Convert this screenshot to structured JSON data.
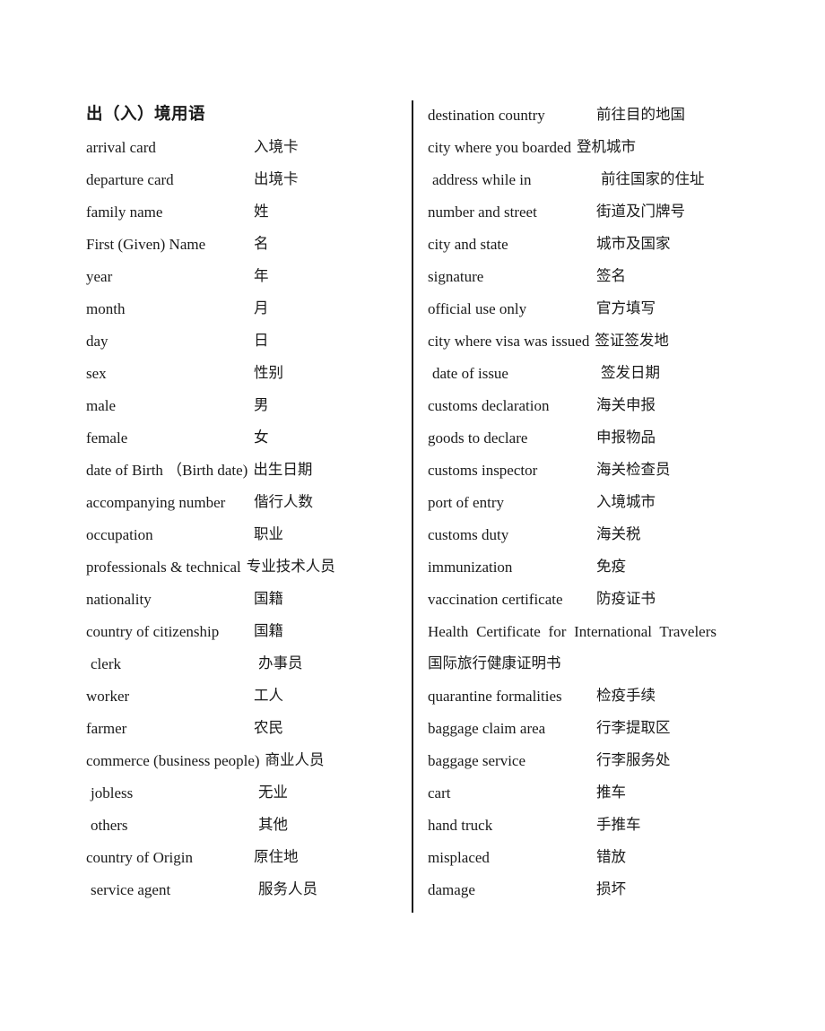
{
  "document": {
    "background_color": "#ffffff",
    "text_color": "#1a1a1a",
    "divider_color": "#1a1a1a"
  },
  "left_column": {
    "title": "出（入）境用语",
    "entries": [
      {
        "en": "arrival card",
        "zh": "入境卡"
      },
      {
        "en": "departure card",
        "zh": "出境卡"
      },
      {
        "en": "family name",
        "zh": "姓"
      },
      {
        "en": "First (Given) Name",
        "zh": "名"
      },
      {
        "en": "year",
        "zh": "年"
      },
      {
        "en": "month",
        "zh": "月"
      },
      {
        "en": "day",
        "zh": "日"
      },
      {
        "en": "sex",
        "zh": "性别"
      },
      {
        "en": "male",
        "zh": "男"
      },
      {
        "en": "female",
        "zh": "女"
      },
      {
        "en": "date of Birth （Birth date)",
        "zh": "出生日期"
      },
      {
        "en": "accompanying number",
        "zh": "偕行人数"
      },
      {
        "en": "occupation",
        "zh": "职业"
      },
      {
        "en": "professionals & technical",
        "zh": "专业技术人员"
      },
      {
        "en": "nationality",
        "zh": "国籍"
      },
      {
        "en": "country of citizenship",
        "zh": "国籍"
      },
      {
        "en": "clerk",
        "zh": "办事员"
      },
      {
        "en": "worker",
        "zh": "工人"
      },
      {
        "en": "farmer",
        "zh": "农民"
      },
      {
        "en": "commerce (business people)",
        "zh": "商业人员"
      },
      {
        "en": "jobless",
        "zh": "无业"
      },
      {
        "en": "others",
        "zh": "其他"
      },
      {
        "en": "country of Origin",
        "zh": "原住地"
      },
      {
        "en": "service agent",
        "zh": "服务人员"
      }
    ]
  },
  "right_column": {
    "entries": [
      {
        "en": "destination country",
        "zh": "前往目的地国"
      },
      {
        "en": "city where you boarded",
        "zh": "登机城市"
      },
      {
        "en": "address while in",
        "zh": "前往国家的住址"
      },
      {
        "en": "number and street",
        "zh": "街道及门牌号"
      },
      {
        "en": "city and state",
        "zh": "城市及国家"
      },
      {
        "en": "signature",
        "zh": "签名"
      },
      {
        "en": "official use only",
        "zh": "官方填写"
      },
      {
        "en": "city where visa was issued",
        "zh": "签证签发地"
      },
      {
        "en": "date of issue",
        "zh": "签发日期"
      },
      {
        "en": "customs declaration",
        "zh": "海关申报"
      },
      {
        "en": "goods to declare",
        "zh": "申报物品"
      },
      {
        "en": "customs inspector",
        "zh": "海关检查员"
      },
      {
        "en": "port of entry",
        "zh": "入境城市"
      },
      {
        "en": "customs duty",
        "zh": "海关税"
      },
      {
        "en": "immunization",
        "zh": "免疫"
      },
      {
        "en": "vaccination certificate",
        "zh": "防疫证书"
      },
      {
        "en": "Health Certificate for International Travelers",
        "zh": "国际旅行健康证明书"
      },
      {
        "en": "quarantine formalities",
        "zh": "检疫手续"
      },
      {
        "en": "baggage claim area",
        "zh": "行李提取区"
      },
      {
        "en": "baggage service",
        "zh": "行李服务处"
      },
      {
        "en": "cart",
        "zh": "推车"
      },
      {
        "en": "hand truck",
        "zh": "手推车"
      },
      {
        "en": "misplaced",
        "zh": "错放"
      },
      {
        "en": "damage",
        "zh": "损坏"
      }
    ]
  }
}
